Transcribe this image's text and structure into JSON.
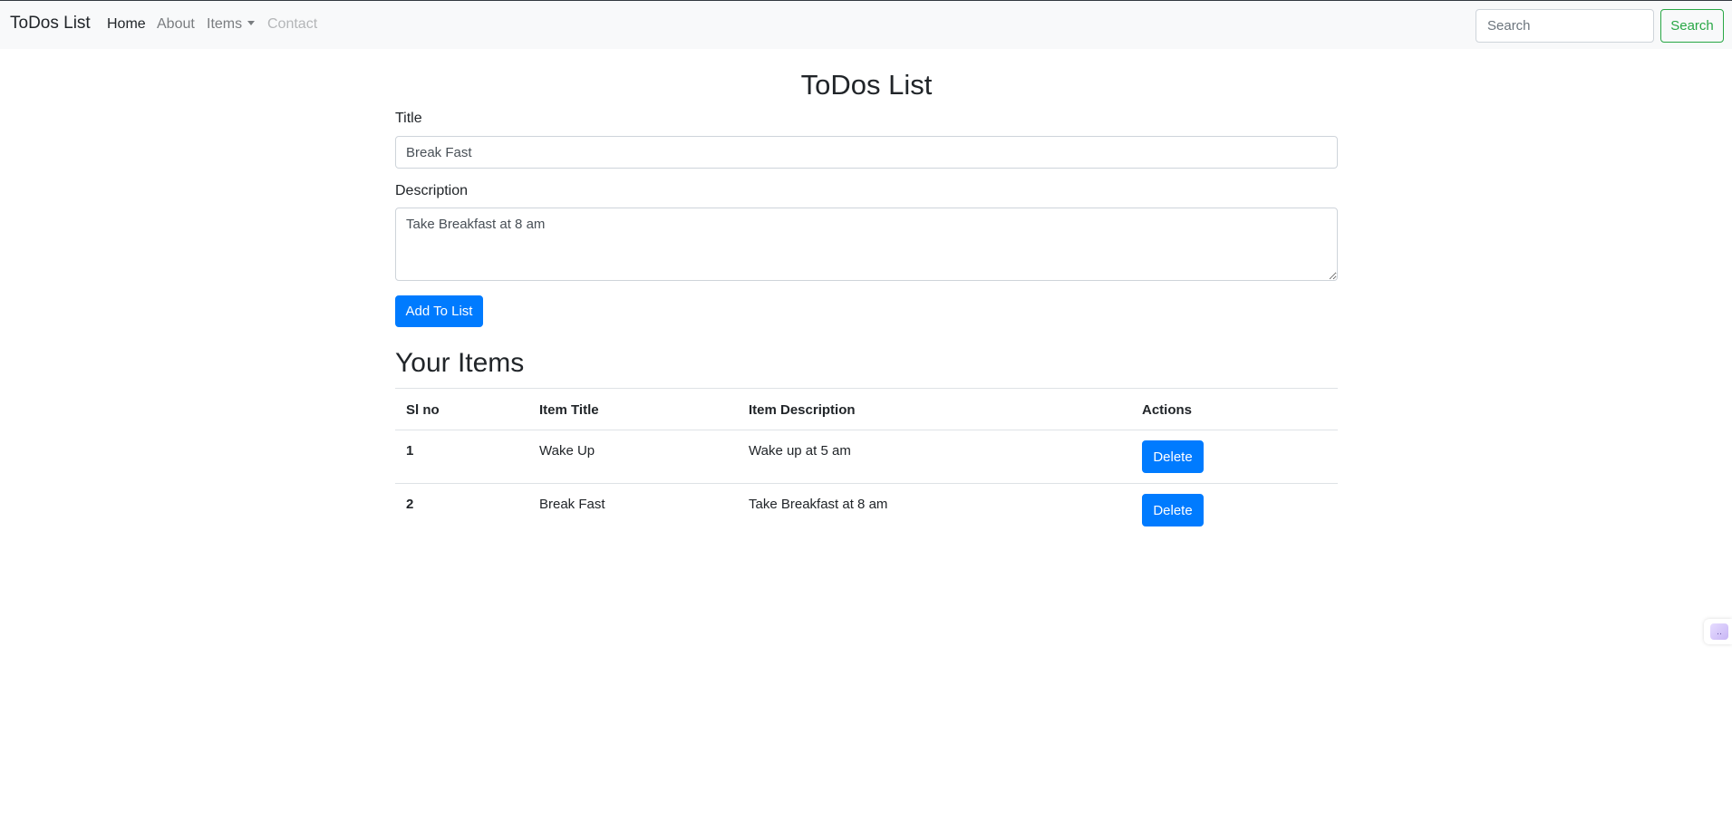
{
  "navbar": {
    "brand": "ToDos List",
    "links": {
      "home": "Home",
      "about": "About",
      "items": "Items",
      "contact": "Contact"
    },
    "search": {
      "placeholder": "Search",
      "button_label": "Search"
    }
  },
  "main": {
    "page_title": "ToDos List",
    "form": {
      "title_label": "Title",
      "title_value": "Break Fast",
      "description_label": "Description",
      "description_value": "Take Breakfast at 8 am",
      "submit_label": "Add To List"
    },
    "section_title": "Your Items",
    "table": {
      "headers": [
        "Sl no",
        "Item Title",
        "Item Description",
        "Actions"
      ],
      "rows": [
        {
          "sl": "1",
          "title": "Wake Up",
          "description": "Wake up at 5 am",
          "action": "Delete"
        },
        {
          "sl": "2",
          "title": "Break Fast",
          "description": "Take Breakfast at 8 am",
          "action": "Delete"
        }
      ]
    }
  },
  "colors": {
    "primary": "#007bff",
    "success": "#28a745",
    "navbar_bg": "#f8f9fa"
  },
  "icons": {
    "items_dropdown": "caret-down-icon",
    "edge_widget": "extension-widget-icon"
  }
}
